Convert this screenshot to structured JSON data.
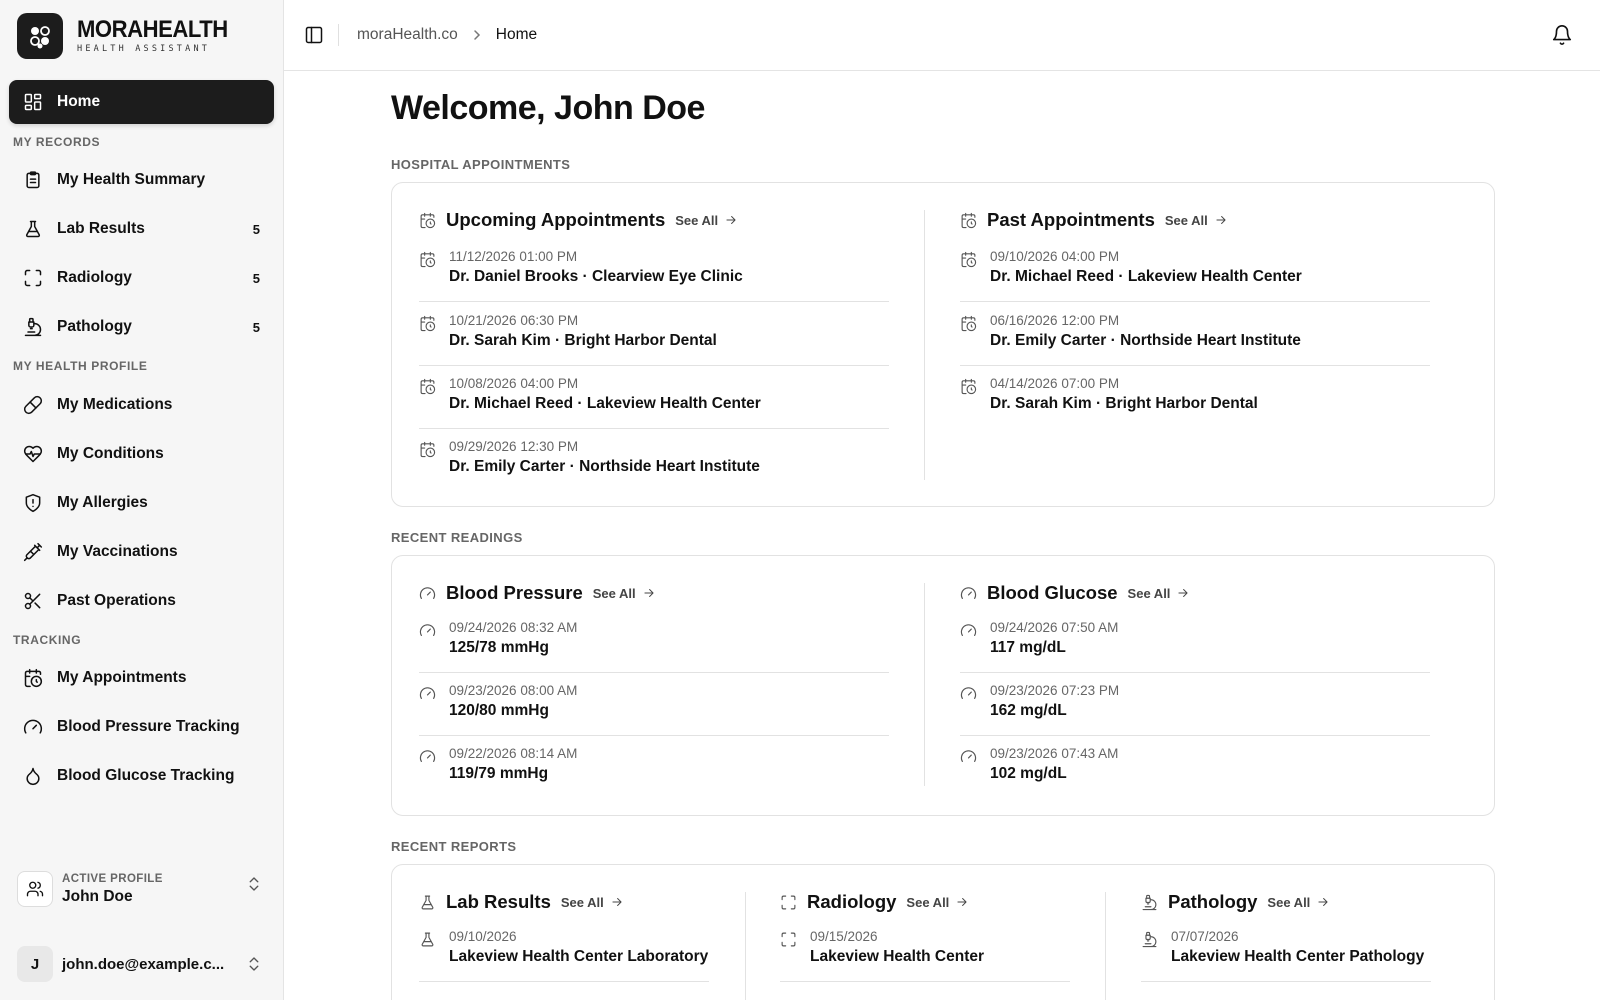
{
  "brand": {
    "name": "MORAHEALTH",
    "subtitle": "HEALTH ASSISTANT"
  },
  "sidebar": {
    "home": "Home",
    "sections": {
      "records": "MY RECORDS",
      "profile": "MY HEALTH PROFILE",
      "tracking": "TRACKING"
    },
    "records": [
      {
        "label": "My Health Summary",
        "icon": "clipboard-icon",
        "count": ""
      },
      {
        "label": "Lab Results",
        "icon": "flask-icon",
        "count": "5"
      },
      {
        "label": "Radiology",
        "icon": "scan-icon",
        "count": "5"
      },
      {
        "label": "Pathology",
        "icon": "microscope-icon",
        "count": "5"
      }
    ],
    "profile_items": [
      {
        "label": "My Medications",
        "icon": "pill-icon"
      },
      {
        "label": "My Conditions",
        "icon": "heart-pulse-icon"
      },
      {
        "label": "My Allergies",
        "icon": "shield-alert-icon"
      },
      {
        "label": "My Vaccinations",
        "icon": "syringe-icon"
      },
      {
        "label": "Past Operations",
        "icon": "scissors-icon"
      }
    ],
    "tracking_items": [
      {
        "label": "My Appointments",
        "icon": "calendar-clock-icon"
      },
      {
        "label": "Blood Pressure Tracking",
        "icon": "gauge-icon"
      },
      {
        "label": "Blood Glucose Tracking",
        "icon": "droplet-icon"
      }
    ],
    "active_profile_label": "ACTIVE PROFILE",
    "active_profile_name": "John Doe",
    "account_initial": "J",
    "account_email": "john.doe@example.c..."
  },
  "topbar": {
    "crumb_root": "moraHealth.co",
    "crumb_current": "Home"
  },
  "main": {
    "welcome": "Welcome, John Doe",
    "see_all": "See All",
    "appointments": {
      "section": "HOSPITAL APPOINTMENTS",
      "upcoming": {
        "title": "Upcoming Appointments",
        "items": [
          {
            "date": "11/12/2026 01:00 PM",
            "text": "Dr. Daniel Brooks · Clearview Eye Clinic"
          },
          {
            "date": "10/21/2026 06:30 PM",
            "text": "Dr. Sarah Kim · Bright Harbor Dental"
          },
          {
            "date": "10/08/2026 04:00 PM",
            "text": "Dr. Michael Reed · Lakeview Health Center"
          },
          {
            "date": "09/29/2026 12:30 PM",
            "text": "Dr. Emily Carter · Northside Heart Institute"
          }
        ]
      },
      "past": {
        "title": "Past Appointments",
        "items": [
          {
            "date": "09/10/2026 04:00 PM",
            "text": "Dr. Michael Reed · Lakeview Health Center"
          },
          {
            "date": "06/16/2026 12:00 PM",
            "text": "Dr. Emily Carter · Northside Heart Institute"
          },
          {
            "date": "04/14/2026 07:00 PM",
            "text": "Dr. Sarah Kim · Bright Harbor Dental"
          }
        ]
      }
    },
    "readings": {
      "section": "RECENT READINGS",
      "bp": {
        "title": "Blood Pressure",
        "items": [
          {
            "date": "09/24/2026 08:32 AM",
            "text": "125/78 mmHg"
          },
          {
            "date": "09/23/2026 08:00 AM",
            "text": "120/80 mmHg"
          },
          {
            "date": "09/22/2026 08:14 AM",
            "text": "119/79 mmHg"
          }
        ]
      },
      "glucose": {
        "title": "Blood Glucose",
        "items": [
          {
            "date": "09/24/2026 07:50 AM",
            "text": "117 mg/dL"
          },
          {
            "date": "09/23/2026 07:23 PM",
            "text": "162 mg/dL"
          },
          {
            "date": "09/23/2026 07:43 AM",
            "text": "102 mg/dL"
          }
        ]
      }
    },
    "reports": {
      "section": "RECENT REPORTS",
      "lab": {
        "title": "Lab Results",
        "items": [
          {
            "date": "09/10/2026",
            "text": "Lakeview Health Center Laboratory"
          }
        ]
      },
      "radiology": {
        "title": "Radiology",
        "items": [
          {
            "date": "09/15/2026",
            "text": "Lakeview Health Center"
          }
        ]
      },
      "pathology": {
        "title": "Pathology",
        "items": [
          {
            "date": "07/07/2026",
            "text": "Lakeview Health Center Pathology"
          }
        ]
      }
    }
  }
}
